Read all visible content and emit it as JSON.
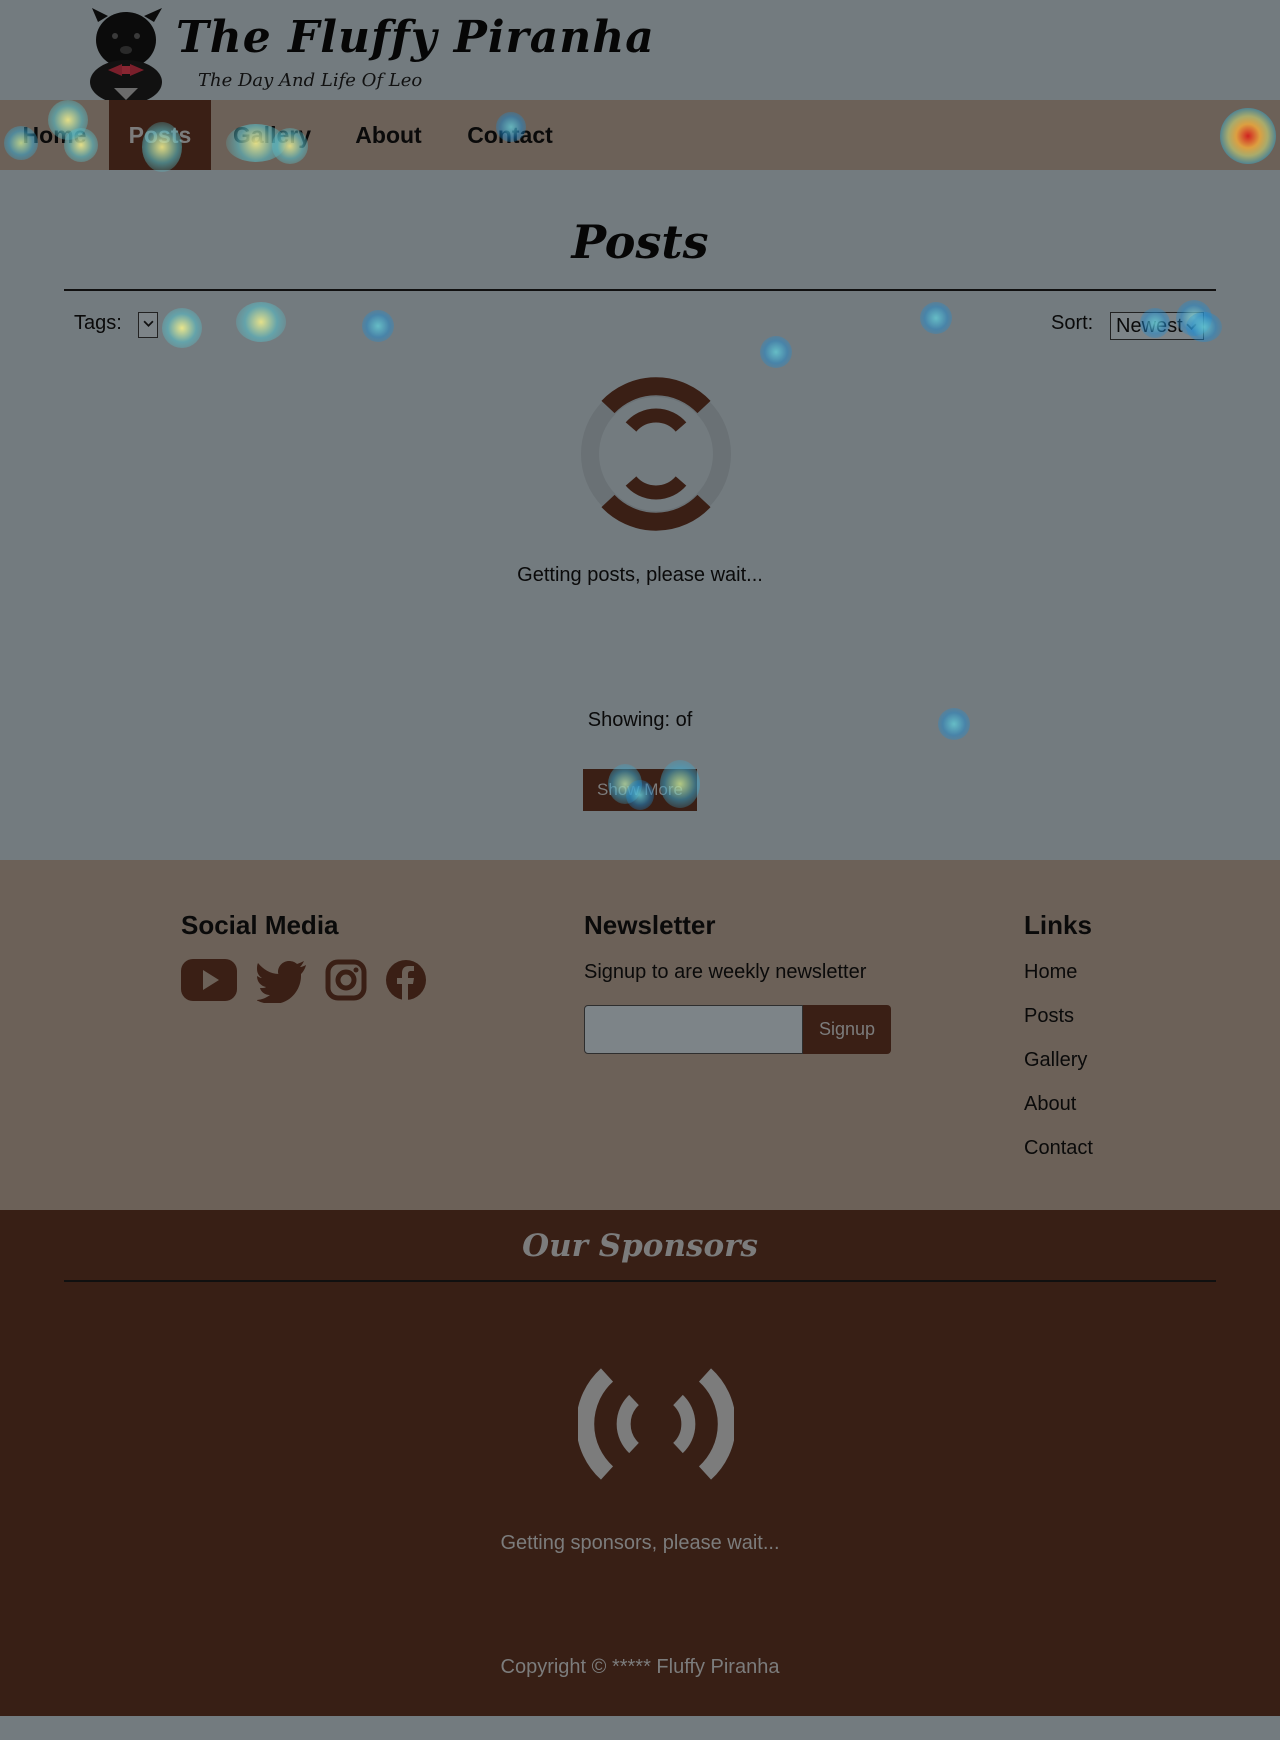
{
  "header": {
    "title": "The Fluffy Piranha",
    "subtitle": "The Day And Life Of Leo",
    "logo_icon": "dog-logo-icon"
  },
  "nav": {
    "items": [
      {
        "label": "Home",
        "active": false
      },
      {
        "label": "Posts",
        "active": true
      },
      {
        "label": "Gallery",
        "active": false
      },
      {
        "label": "About",
        "active": false
      },
      {
        "label": "Contact",
        "active": false
      }
    ]
  },
  "main": {
    "title": "Posts",
    "tags_label": "Tags:",
    "sort_label": "Sort:",
    "sort_value": "Newest",
    "loading_text": "Getting posts, please wait...",
    "showing_text": "Showing: of",
    "show_more_label": "Show More"
  },
  "footer": {
    "social": {
      "heading": "Social Media",
      "icons": [
        "youtube-icon",
        "twitter-icon",
        "instagram-icon",
        "facebook-icon"
      ]
    },
    "newsletter": {
      "heading": "Newsletter",
      "description": "Signup to are weekly newsletter",
      "email_value": "",
      "signup_label": "Signup"
    },
    "links": {
      "heading": "Links",
      "items": [
        "Home",
        "Posts",
        "Gallery",
        "About",
        "Contact"
      ]
    }
  },
  "sponsors": {
    "title": "Our Sponsors",
    "loading_text": "Getting sponsors, please wait..."
  },
  "copyright": "Copyright © ***** Fluffy Piranha",
  "colors": {
    "page_bg": "#737b7f",
    "nav_bg": "#6c6158",
    "accent_dark": "#3a1f15",
    "sponsors_bg": "#381f15",
    "muted_text": "#7c7c7c"
  }
}
